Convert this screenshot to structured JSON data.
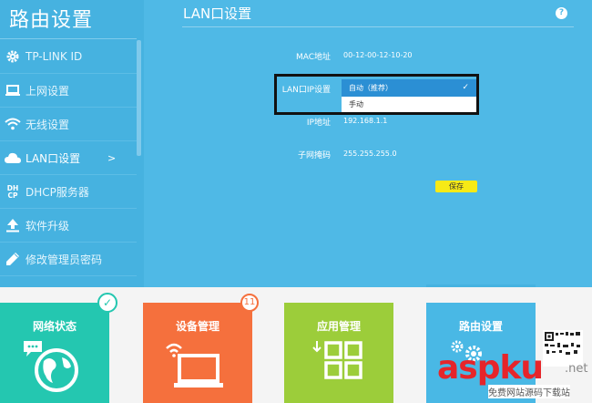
{
  "sidebar": {
    "title": "路由设置",
    "items": [
      {
        "label": "TP-LINK ID",
        "icon": "gear-icon"
      },
      {
        "label": "上网设置",
        "icon": "monitor-icon"
      },
      {
        "label": "无线设置",
        "icon": "wifi-icon"
      },
      {
        "label": "LAN口设置",
        "icon": "cloud-icon",
        "arrow": ">"
      },
      {
        "label": "DHCP服务器",
        "icon": "dhcp-icon",
        "icon_text": "DHCP"
      },
      {
        "label": "软件升级",
        "icon": "upload-icon"
      },
      {
        "label": "修改管理员密码",
        "icon": "pencil-icon"
      }
    ]
  },
  "panel": {
    "title": "LAN口设置",
    "help": "?",
    "mac_label": "MAC地址",
    "mac_value": "00-12-00-12-10-20",
    "lanip_label": "LAN口IP设置",
    "dropdown_selected": "自动（推荐）",
    "dropdown_check": "✓",
    "dropdown_option": "手动",
    "ip_label": "IP地址",
    "ip_value": "192.168.1.1",
    "mask_label": "子网掩码",
    "mask_value": "255.255.255.0",
    "save_label": "保存"
  },
  "tiles": {
    "network_status": "网络状态",
    "device_mgmt": "设备管理",
    "device_badge": "11",
    "app_mgmt": "应用管理",
    "route_settings": "路由设置",
    "status_check": "✓"
  },
  "watermark": {
    "main": "aspku",
    "net": ".net",
    "sub": "免费网站源码下载站"
  },
  "colors": {
    "sidebar_bg": "#46b2e0",
    "panel_bg": "#4fb9e6",
    "network_tile": "#24c7b0",
    "device_tile": "#f5703d",
    "app_tile": "#9ccd3a",
    "route_tile": "#49b8e5",
    "save_button": "#f7ea16"
  }
}
